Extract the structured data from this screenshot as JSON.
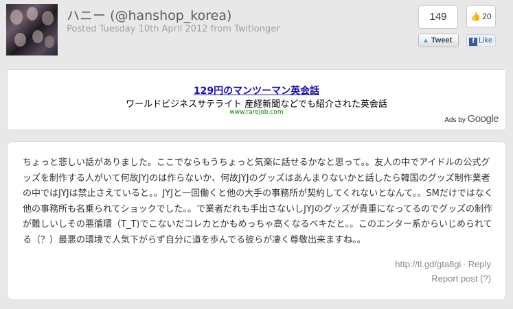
{
  "header": {
    "author_name": "ハニー (@hanshop_korea)",
    "meta_line": "Posted Tuesday 10th April 2012 from Twitlonger"
  },
  "share": {
    "tweet_count": "149",
    "tweet_label": "Tweet",
    "like_count": "20",
    "like_label": "Like"
  },
  "ad": {
    "title": "129円のマンツーマン英会話",
    "description": "ワールドビジネスサテライト 産経新聞などでも紹介された英会話",
    "url": "www.rarejob.com",
    "ads_by_label": "Ads by",
    "google_label": "Google"
  },
  "post": {
    "body": "ちょっと悲しい話がありました。ここでならもうちょっと気楽に話せるかなと思って。。友人の中でアイドルの公式グッズを制作する人がいて何故JYJのは作らないか、何故JYJのグッズはあんまりないかと話したら韓国のグッズ制作業者の中ではJYJは禁止さえていると。。JYJと一回働くと他の大手の事務所が契約してくれないとなんて。。SMだけではなく他の事務所も名乗られてショックでした。。で業者だれも手出さないしJYJのグッズが貴重になってるのでグッズの制作が難しいしその悪循環（T_T)でこないだコレカとかもめっちゃ高くなるベキだと。。このエンター系からいじめられてる（？）最悪の環境で人気下がらず自分に道を歩んでる彼らが凄く尊敬出来ますね。。",
    "short_link": "http://tl.gd/gta8gi",
    "separator": "·",
    "reply_label": "Reply",
    "report_label": "Report post (?)"
  }
}
